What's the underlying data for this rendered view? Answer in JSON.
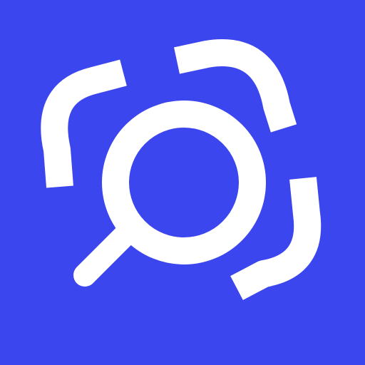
{
  "icon": {
    "name": "scan-search-icon",
    "background_color": "#3C46EE",
    "foreground_color": "#FFFFFF"
  }
}
